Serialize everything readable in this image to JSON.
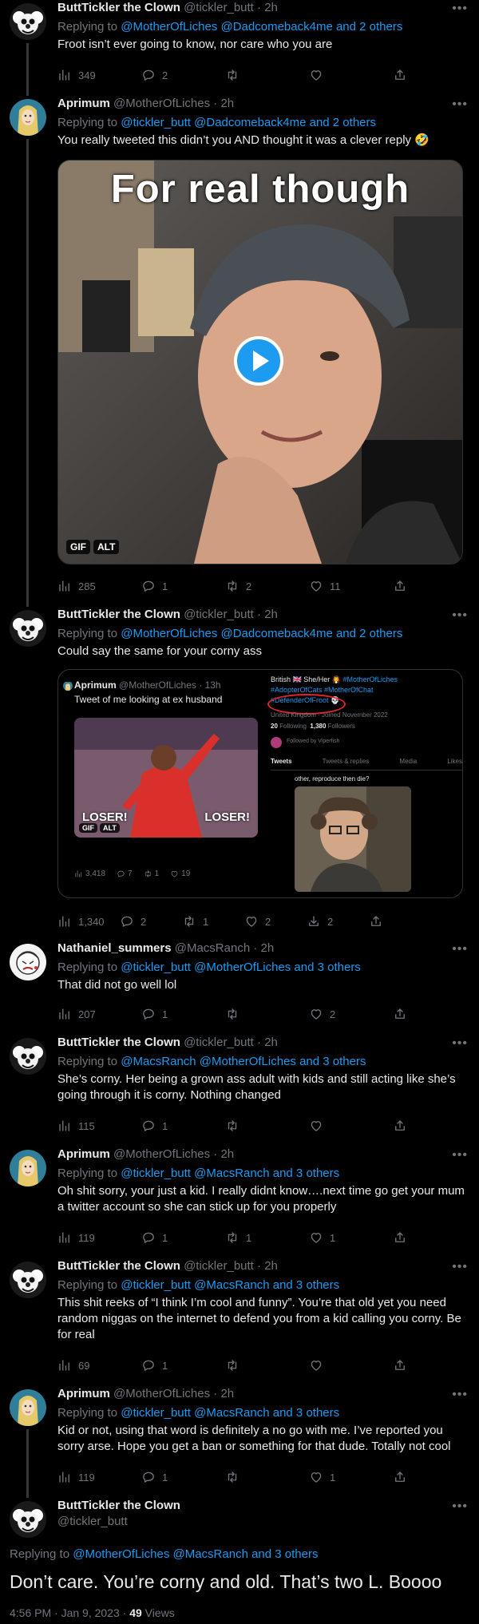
{
  "tweets": [
    {
      "name": "ButtTickler the Clown",
      "handle": "@tickler_butt",
      "time": "2h",
      "replying_prefix": "Replying to ",
      "replying_to": "@MotherOfLiches @Dadcomeback4me and 2 others",
      "text": "Froot isn’t ever going to know, nor care who you are",
      "views": "349",
      "replies": "2",
      "retweets": "",
      "likes": ""
    },
    {
      "name": "Aprimum",
      "handle": "@MotherOfLiches",
      "time": "2h",
      "replying_prefix": "Replying to ",
      "replying_to": "@tickler_butt @Dadcomeback4me and 2 others",
      "text": "You really tweeted this didn’t you AND thought it was a clever reply 🤣",
      "media_caption": "For real though",
      "media_badges": [
        "GIF",
        "ALT"
      ],
      "views": "285",
      "replies": "1",
      "retweets": "2",
      "likes": "11"
    },
    {
      "name": "ButtTickler the Clown",
      "handle": "@tickler_butt",
      "time": "2h",
      "replying_prefix": "Replying to ",
      "replying_to": "@MotherOfLiches @Dadcomeback4me and 2 others",
      "text": "Could say the same for your corny ass",
      "views": "1,340",
      "replies": "2",
      "retweets": "1",
      "likes": "2",
      "bookmarks": "2"
    },
    {
      "name": "Nathaniel_summers",
      "handle": "@MacsRanch",
      "time": "2h",
      "replying_prefix": "Replying to ",
      "replying_to": "@tickler_butt @MotherOfLiches and 3 others",
      "text": "That did not go well lol",
      "views": "207",
      "replies": "1",
      "retweets": "",
      "likes": "2"
    },
    {
      "name": "ButtTickler the Clown",
      "handle": "@tickler_butt",
      "time": "2h",
      "replying_prefix": "Replying to ",
      "replying_to": "@MacsRanch @MotherOfLiches and 3 others",
      "text": "She’s corny. Her being a grown ass adult with kids and still acting like she’s going through it is corny. Nothing changed",
      "views": "115",
      "replies": "1",
      "retweets": "",
      "likes": ""
    },
    {
      "name": "Aprimum",
      "handle": "@MotherOfLiches",
      "time": "2h",
      "replying_prefix": "Replying to ",
      "replying_to": "@tickler_butt @MacsRanch and 3 others",
      "text": "Oh shit sorry,  your just a kid. I really didnt know….next time go get your mum a twitter account so she can stick up for you properly",
      "views": "119",
      "replies": "1",
      "retweets": "1",
      "likes": "1"
    },
    {
      "name": "ButtTickler the Clown",
      "handle": "@tickler_butt",
      "time": "2h",
      "replying_prefix": "Replying to ",
      "replying_to": "@tickler_butt @MacsRanch and 3 others",
      "text": "This shit reeks of “I think I’m cool and funny”. You’re that old yet you need random niggas on the internet to defend you from a kid calling you corny. Be for real",
      "views": "69",
      "replies": "1",
      "retweets": "",
      "likes": ""
    },
    {
      "name": "Aprimum",
      "handle": "@MotherOfLiches",
      "time": "2h",
      "replying_prefix": "Replying to ",
      "replying_to": "@tickler_butt @MacsRanch and 3 others",
      "text": "Kid or not, using that word is definitely a no go with me. I’ve reported you sorry arse. Hope you get a ban or something for that dude. Totally not cool",
      "views": "119",
      "replies": "1",
      "retweets": "",
      "likes": "1"
    }
  ],
  "quoted_screenshot": {
    "left": {
      "name": "Aprimum",
      "handle": "@MotherOfLiches",
      "time": "13h",
      "text": "Tweet of me looking at ex husband",
      "loser_left": "LOSER!",
      "loser_right": "LOSER!",
      "badges": [
        "GIF",
        "ALT"
      ],
      "views": "3,418",
      "replies": "7",
      "retweets": "1",
      "likes": "19"
    },
    "right": {
      "bio_line1": "British 🇬🇧 She/Her 🧛 ",
      "bio_tag1": "#MotherOfLiches",
      "bio_line2": "#AdopterOfCats #MotherOfChat",
      "bio_tag3": "#DefenderOfFroot 💀",
      "location": "United Kingdom · Joined November 2022",
      "following_count": "20",
      "following_label": "Following",
      "followers_count": "1,380",
      "followers_label": "Followers",
      "followed_by": "Followed by Viperfish",
      "tabs": [
        "Tweets",
        "Tweets & replies",
        "Media",
        "Likes"
      ],
      "clip_text": "other, reproduce then die?"
    }
  },
  "main_tweet": {
    "name": "ButtTickler the Clown",
    "handle": "@tickler_butt",
    "replying_prefix": "Replying to ",
    "replying_to": "@MotherOfLiches @MacsRanch and 3 others",
    "text": "Don’t care. You’re corny and old. That’s two L. Boooo",
    "timestamp": "4:56 PM · Jan 9, 2023 · ",
    "views_count": "49",
    "views_label": " Views"
  },
  "colors": {
    "background": "#000000",
    "text": "#e7e9ea",
    "muted": "#71767b",
    "link": "#1d9bf0",
    "thread_line": "#333639"
  },
  "icons": [
    "views-icon",
    "reply-icon",
    "retweet-icon",
    "like-icon",
    "share-icon",
    "bookmark-icon",
    "play-icon",
    "more-icon"
  ]
}
